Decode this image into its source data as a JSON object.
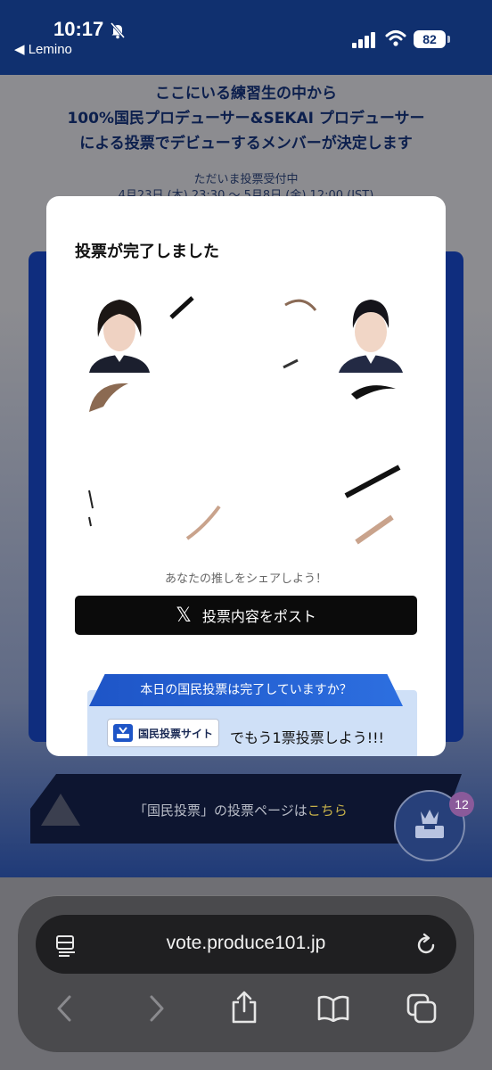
{
  "status_bar": {
    "time": "10:17",
    "back_app": "◀ Lemino",
    "battery": "82"
  },
  "page": {
    "hero_lines": [
      "ここにいる練習生の中から",
      "100%国民プロデューサー&SEKAI プロデューサー",
      "による投票でデビューするメンバーが決定します"
    ],
    "status_label": "ただいま投票受付中",
    "period": "4月23日 (木) 23:30 ～ 5月8日 (金) 12:00 (JST)",
    "banner_text_prefix": "「国民投票」の投票ページは",
    "banner_link": "こちら",
    "fab_badge": "12"
  },
  "modal": {
    "title": "投票が完了しました",
    "share_prompt": "あなたの推しをシェアしよう！",
    "post_button_label": "投票内容をポスト",
    "post_icon": "x-logo-icon",
    "cta_ribbon": "本日の国民投票は完了していますか？",
    "site_chip_label": "国民投票サイト",
    "vote_again_text": "でもう1票投票しよう!!!"
  },
  "browser": {
    "url": "vote.produce101.jp"
  },
  "colors": {
    "status_bar": "#10306f",
    "cta_blue": "#1e55c7",
    "button_black": "#0b0b0b"
  }
}
